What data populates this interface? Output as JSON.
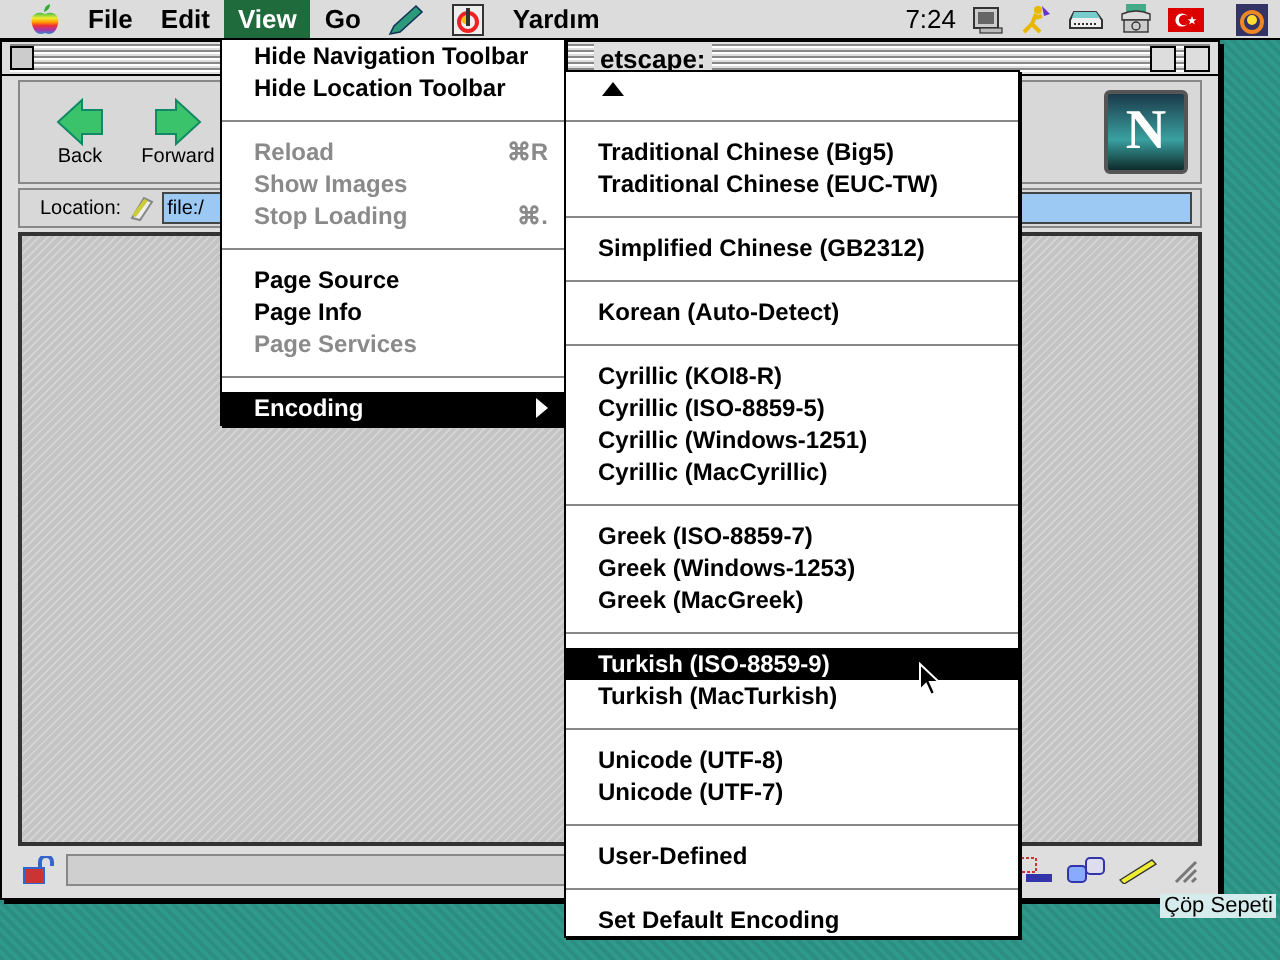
{
  "menu_bar": {
    "menus": [
      {
        "kind": "apple",
        "selected": false
      },
      {
        "kind": "text",
        "label": "File",
        "selected": false
      },
      {
        "kind": "text",
        "label": "Edit",
        "selected": false
      },
      {
        "kind": "text",
        "label": "View",
        "selected": true
      },
      {
        "kind": "text",
        "label": "Go",
        "selected": false
      },
      {
        "kind": "pencil",
        "selected": false
      },
      {
        "kind": "app",
        "selected": false
      },
      {
        "kind": "text",
        "label": "Yardım",
        "selected": false
      }
    ],
    "clock": "7:24"
  },
  "window": {
    "title": "etscape:",
    "toolbar": {
      "buttons": [
        {
          "label": "Back"
        },
        {
          "label": "Forward"
        }
      ],
      "logo_text": "N"
    },
    "location": {
      "label": "Location:",
      "url": "file:/"
    }
  },
  "view_menu": {
    "items": [
      {
        "kind": "item",
        "label": "Hide Navigation Toolbar",
        "disabled": false,
        "selected": false
      },
      {
        "kind": "item",
        "label": "Hide Location Toolbar",
        "disabled": false,
        "selected": false
      },
      {
        "kind": "separator"
      },
      {
        "kind": "item",
        "label": "Reload",
        "shortcut": "⌘R",
        "disabled": true,
        "selected": false
      },
      {
        "kind": "item",
        "label": "Show Images",
        "disabled": true,
        "selected": false
      },
      {
        "kind": "item",
        "label": "Stop Loading",
        "shortcut": "⌘.",
        "disabled": true,
        "selected": false
      },
      {
        "kind": "separator"
      },
      {
        "kind": "item",
        "label": "Page Source",
        "disabled": false,
        "selected": false
      },
      {
        "kind": "item",
        "label": "Page Info",
        "disabled": false,
        "selected": false
      },
      {
        "kind": "item",
        "label": "Page Services",
        "disabled": true,
        "selected": false
      },
      {
        "kind": "separator"
      },
      {
        "kind": "submenu",
        "label": "Encoding",
        "disabled": false,
        "selected": true
      }
    ]
  },
  "encoding_menu": {
    "items": [
      {
        "kind": "scroll_up"
      },
      {
        "kind": "separator"
      },
      {
        "kind": "item",
        "label": "Traditional Chinese (Big5)",
        "selected": false
      },
      {
        "kind": "item",
        "label": "Traditional Chinese (EUC-TW)",
        "selected": false
      },
      {
        "kind": "separator"
      },
      {
        "kind": "item",
        "label": "Simplified Chinese (GB2312)",
        "selected": false
      },
      {
        "kind": "separator"
      },
      {
        "kind": "item",
        "label": "Korean (Auto-Detect)",
        "selected": false
      },
      {
        "kind": "separator"
      },
      {
        "kind": "item",
        "label": "Cyrillic (KOI8-R)",
        "selected": false
      },
      {
        "kind": "item",
        "label": "Cyrillic (ISO-8859-5)",
        "selected": false
      },
      {
        "kind": "item",
        "label": "Cyrillic (Windows-1251)",
        "selected": false
      },
      {
        "kind": "item",
        "label": "Cyrillic (MacCyrillic)",
        "selected": false
      },
      {
        "kind": "separator"
      },
      {
        "kind": "item",
        "label": "Greek (ISO-8859-7)",
        "selected": false
      },
      {
        "kind": "item",
        "label": "Greek (Windows-1253)",
        "selected": false
      },
      {
        "kind": "item",
        "label": "Greek (MacGreek)",
        "selected": false
      },
      {
        "kind": "separator"
      },
      {
        "kind": "item",
        "label": "Turkish (ISO-8859-9)",
        "selected": true
      },
      {
        "kind": "item",
        "label": "Turkish (MacTurkish)",
        "selected": false
      },
      {
        "kind": "separator"
      },
      {
        "kind": "item",
        "label": "Unicode (UTF-8)",
        "selected": false
      },
      {
        "kind": "item",
        "label": "Unicode (UTF-7)",
        "selected": false
      },
      {
        "kind": "separator"
      },
      {
        "kind": "item",
        "label": "User-Defined",
        "selected": false
      },
      {
        "kind": "separator"
      },
      {
        "kind": "item",
        "label": "Set Default Encoding",
        "selected": false
      }
    ]
  },
  "desktop": {
    "trash_label": "Çöp Sepeti"
  }
}
